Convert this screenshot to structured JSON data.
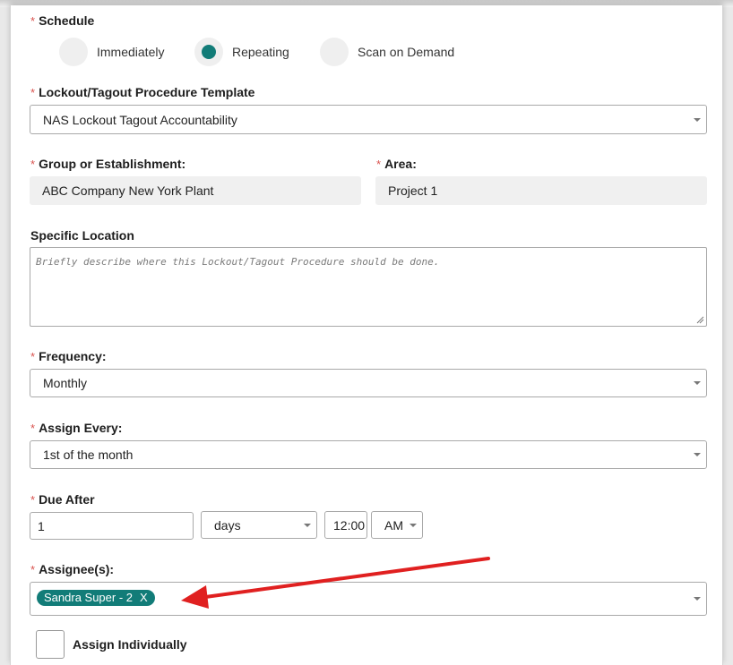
{
  "schedule": {
    "label": "Schedule",
    "options": [
      {
        "label": "Immediately",
        "selected": false
      },
      {
        "label": "Repeating",
        "selected": true
      },
      {
        "label": "Scan on Demand",
        "selected": false
      }
    ]
  },
  "template": {
    "label": "Lockout/Tagout Procedure Template",
    "value": "NAS Lockout Tagout Accountability"
  },
  "group": {
    "label": "Group or Establishment:",
    "value": "ABC Company New York Plant"
  },
  "area": {
    "label": "Area:",
    "value": "Project 1"
  },
  "location": {
    "label": "Specific Location",
    "placeholder": "Briefly describe where this Lockout/Tagout Procedure should be done."
  },
  "frequency": {
    "label": "Frequency:",
    "value": "Monthly"
  },
  "assign_every": {
    "label": "Assign Every:",
    "value": "1st of the month"
  },
  "due_after": {
    "label": "Due After",
    "amount": "1",
    "unit": "days",
    "time": "12:00",
    "ampm": "AM"
  },
  "assignees": {
    "label": "Assignee(s):",
    "tags": [
      {
        "name": "Sandra Super - 2",
        "remove": "X"
      }
    ]
  },
  "assign_individually": {
    "label": "Assign Individually"
  },
  "required_marker": "*",
  "colors": {
    "accent": "#127c78",
    "required": "#d9534f",
    "annotation_arrow": "#e02020"
  }
}
